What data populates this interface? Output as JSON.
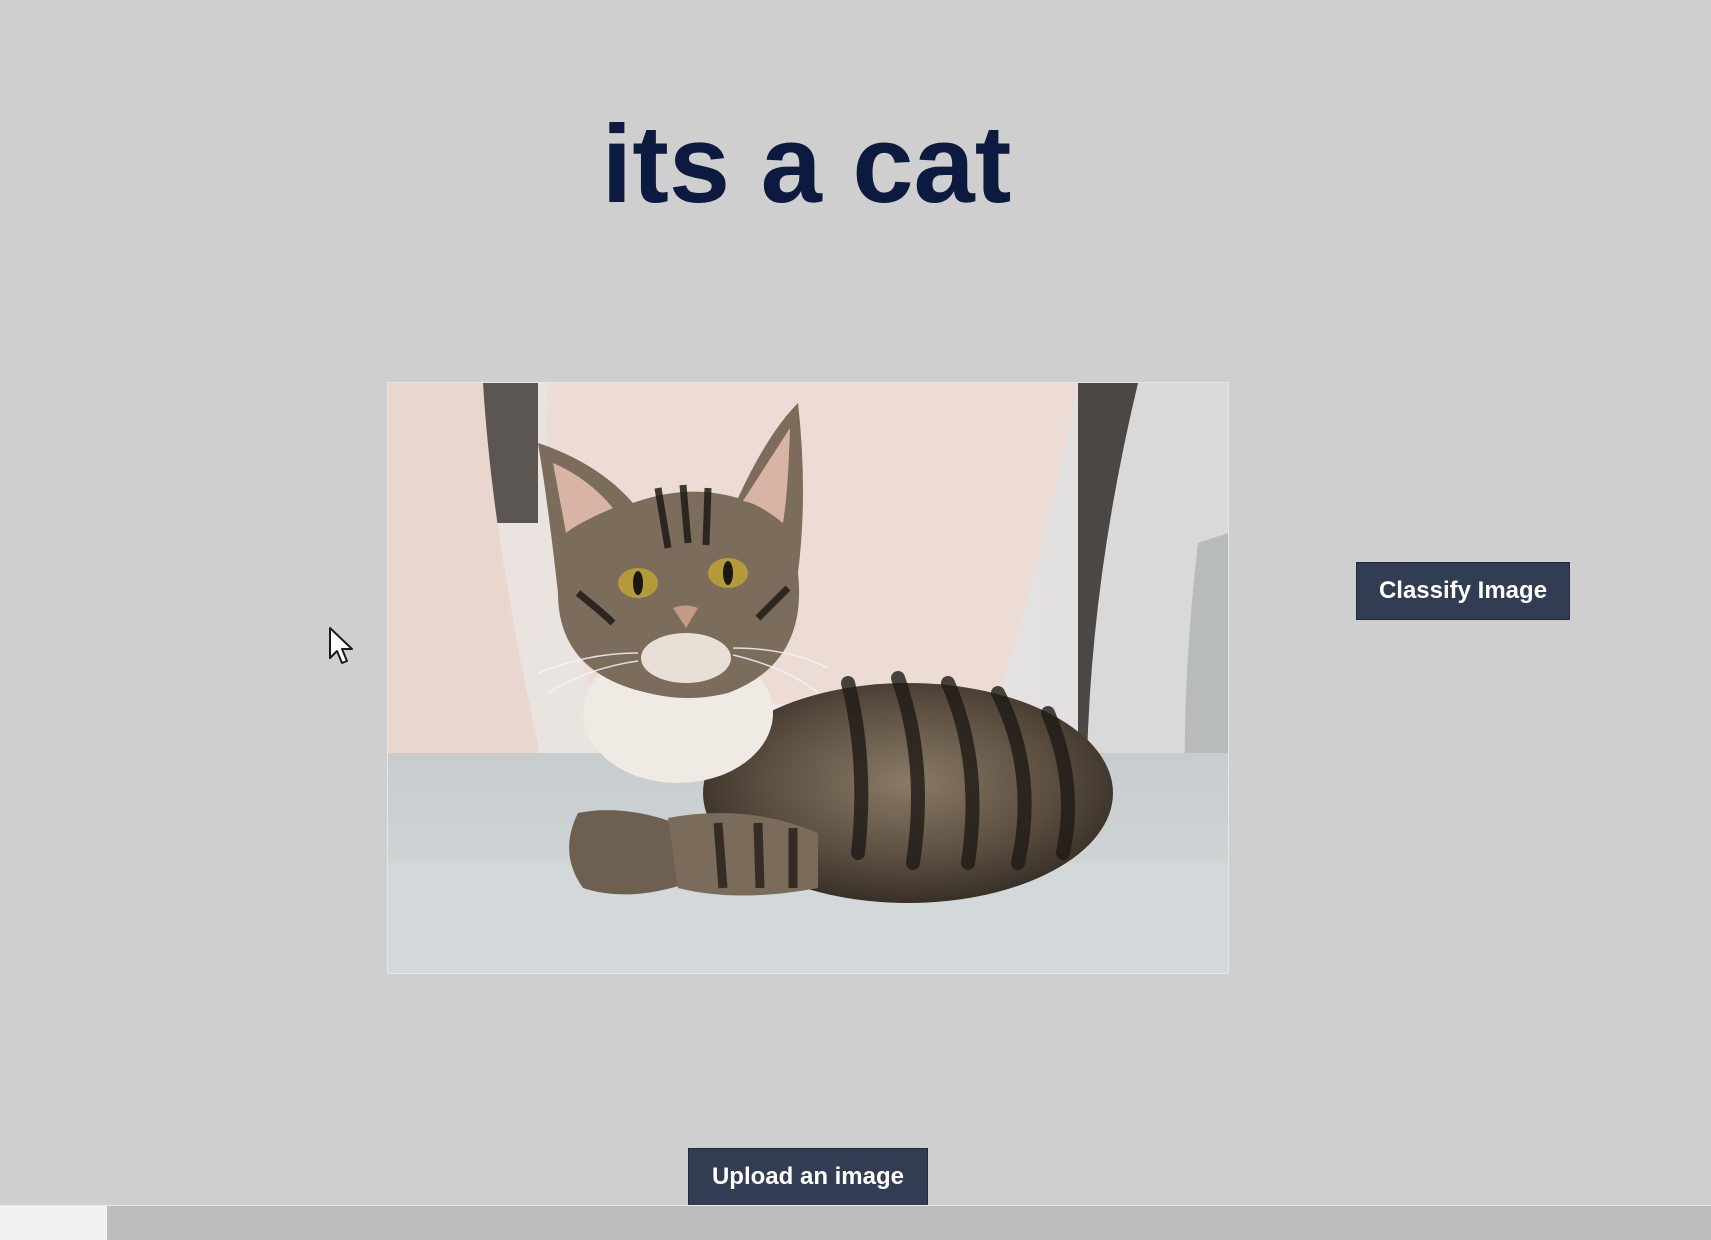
{
  "result": {
    "title": "its a cat"
  },
  "preview": {
    "image_subject": "tabby cat lying on a gray sofa with pillows"
  },
  "actions": {
    "classify_label": "Classify Image",
    "upload_label": "Upload an image"
  },
  "colors": {
    "background": "#cfcfcf",
    "title": "#0b1a3e",
    "button": "#323c52",
    "button_text": "#ffffff"
  },
  "icons": {
    "cursor": "mouse-pointer-icon"
  }
}
